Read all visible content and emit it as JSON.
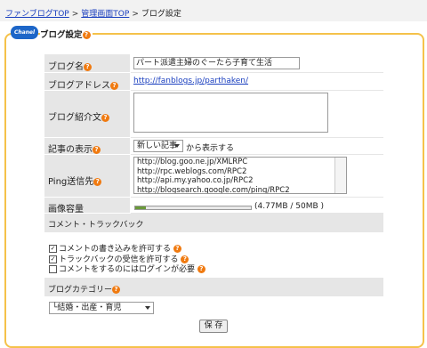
{
  "breadcrumb": {
    "items": [
      "ファンブログTOP",
      "管理画面TOP"
    ],
    "current": "ブログ設定",
    "separator": ">"
  },
  "panel": {
    "badge": "Chanel",
    "title": "ブログ設定"
  },
  "help_icon": "?",
  "form": {
    "blog_name": {
      "label": "ブログ名",
      "value": "パート派遣主婦のぐーたら子育て生活"
    },
    "blog_address": {
      "label": "ブログアドレス",
      "value": "http://fanblogs.jp/parthaken/"
    },
    "blog_intro": {
      "label": "ブログ紹介文",
      "value": ""
    },
    "display": {
      "label": "記事の表示",
      "select": "新しい記事",
      "suffix": "から表示する"
    },
    "ping": {
      "label": "Ping送信先",
      "items": [
        "http://blog.goo.ne.jp/XMLRPC",
        "http://rpc.weblogs.com/RPC2",
        "http://api.my.yahoo.co.jp/RPC2",
        "http://blogsearch.google.com/ping/RPC2"
      ]
    },
    "capacity": {
      "label": "画像容量",
      "text": "(4.77MB / 50MB )",
      "used_fraction": 0.095
    }
  },
  "comment": {
    "header": "コメント・トラックバック",
    "options": [
      {
        "label": "コメントの書き込みを許可する",
        "checked": true
      },
      {
        "label": "トラックバックの受信を許可する",
        "checked": true
      },
      {
        "label": "コメントをするのにはログインが必要",
        "checked": false
      }
    ]
  },
  "category": {
    "header": "ブログカテゴリー",
    "select": "└結婚・出産・育児"
  },
  "save_button": "保 存"
}
